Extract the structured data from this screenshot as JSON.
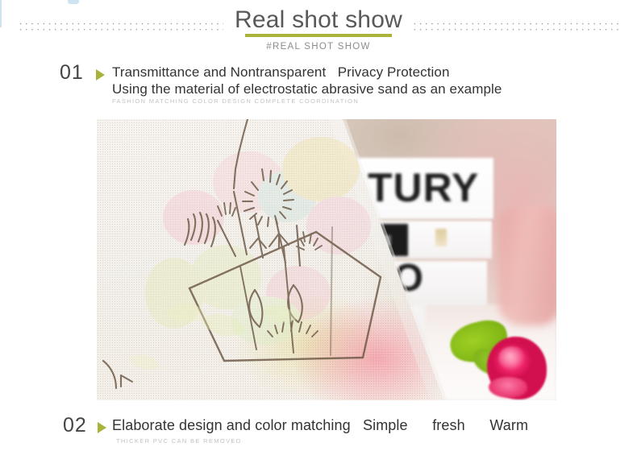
{
  "header": {
    "title": "Real shot show",
    "subtitle": "#REAL SHOT SHOW",
    "accent_color": "#a9b23a",
    "dot_color": "#9a9a9a",
    "title_color": "#595959",
    "subtitle_color": "#8c8c8c"
  },
  "decor": {
    "left_edge_color": "#cfe2ef",
    "top_dot_color": "#cfe4f2"
  },
  "sections": [
    {
      "number": "01",
      "marker": "play-triangle",
      "marker_color": "#a9b23a",
      "line1": "Transmittance and Nontransparent   Privacy Protection",
      "line2": "Using the material of electrostatic abrasive sand as an example",
      "caption": "FASHION MATCHING COLOR DESIGN COMPLETE COORDINATION"
    },
    {
      "number": "02",
      "marker": "play-triangle",
      "marker_color": "#a9b23a",
      "line1": "Elaborate design and color matching   Simple      fresh      Warm",
      "caption": "THICKER PVC CAN BE REMOVED"
    }
  ],
  "photo": {
    "alt": "frosted privacy window film with botanical line art over a desk scene",
    "book_top_text": "TURY",
    "book_bottom_text": "RO",
    "film_tone": "#f3efe9",
    "glow_pink": "#f66e82",
    "glow_yellow": "#e1d778",
    "rose_color": "#e6286a",
    "leaf_color": "#86bb18"
  }
}
